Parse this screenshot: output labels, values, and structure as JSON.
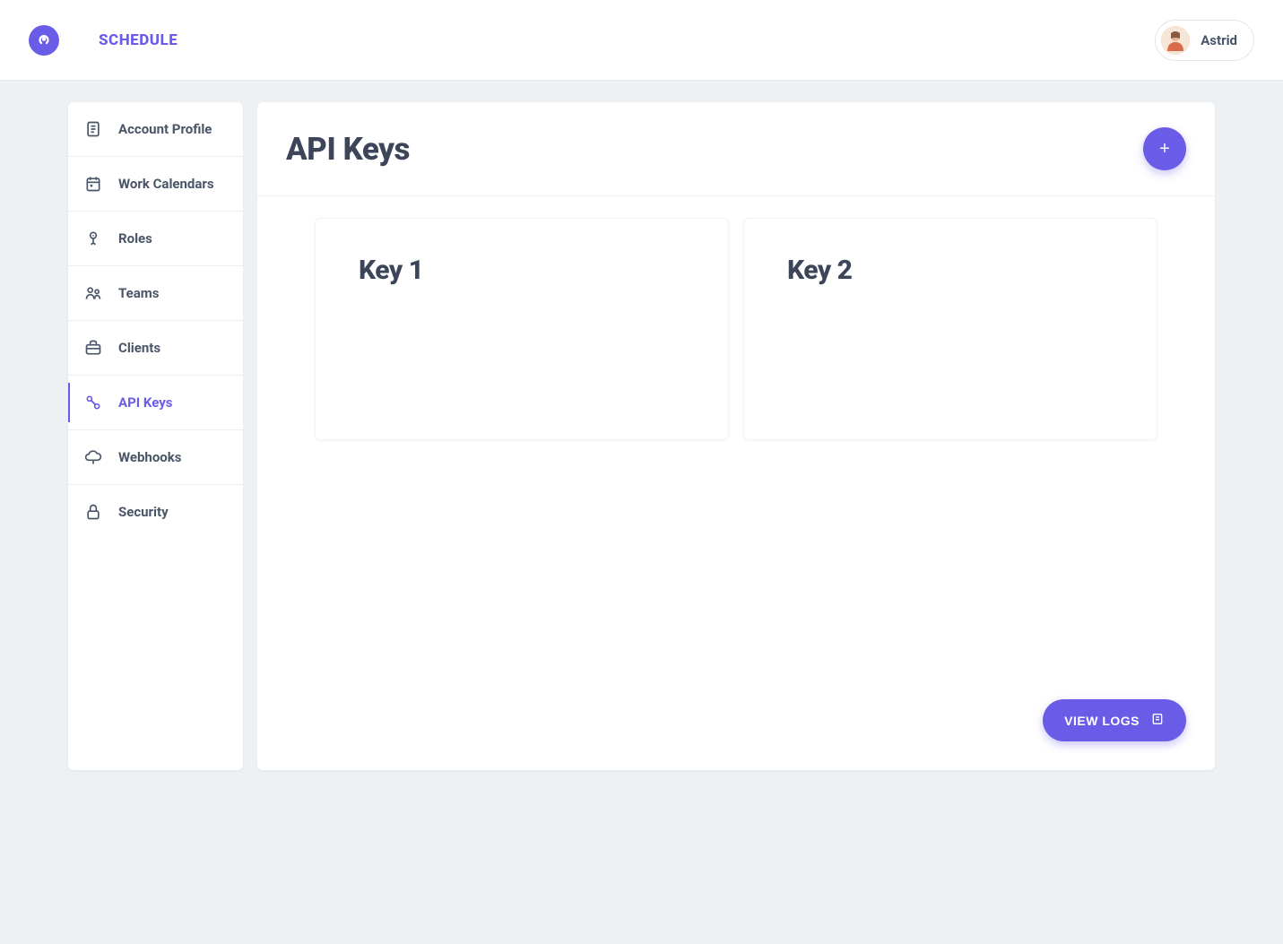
{
  "header": {
    "app_name": "SCHEDULE",
    "user_name": "Astrid"
  },
  "sidebar": {
    "items": [
      {
        "label": "Account Profile",
        "icon": "document-icon",
        "active": false
      },
      {
        "label": "Work Calendars",
        "icon": "calendar-icon",
        "active": false
      },
      {
        "label": "Roles",
        "icon": "roles-icon",
        "active": false
      },
      {
        "label": "Teams",
        "icon": "teams-icon",
        "active": false
      },
      {
        "label": "Clients",
        "icon": "briefcase-icon",
        "active": false
      },
      {
        "label": "API Keys",
        "icon": "keys-icon",
        "active": true
      },
      {
        "label": "Webhooks",
        "icon": "cloud-icon",
        "active": false
      },
      {
        "label": "Security",
        "icon": "lock-icon",
        "active": false
      }
    ]
  },
  "main": {
    "title": "API Keys",
    "add_label": "+",
    "view_logs_label": "VIEW LOGS",
    "cards": [
      {
        "title": "Key 1"
      },
      {
        "title": "Key 2"
      }
    ]
  },
  "colors": {
    "accent": "#6b5ce7",
    "text": "#4a5568",
    "heading": "#3d4659",
    "bg": "#eef1f3"
  }
}
